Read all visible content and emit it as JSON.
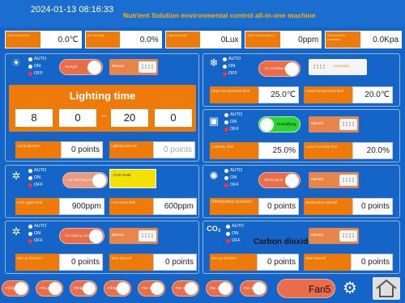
{
  "header": {
    "datetime": "2024-01-13 08:16:33",
    "title": "Nutrient Solution environmental control all-in-one machine"
  },
  "sensors": [
    {
      "label": "Air temperature",
      "value": "0.0℃"
    },
    {
      "label": "Air humidity",
      "value": "0.0%"
    },
    {
      "label": "Light intensity",
      "value": "0Lux"
    },
    {
      "label": "CO2 concentration",
      "value": "0ppm"
    },
    {
      "label": "Atmospheric pressure",
      "value": "0.0Kpa"
    }
  ],
  "modes": {
    "auto": "AUTO",
    "on": "ON",
    "off": "OFF"
  },
  "lighting": {
    "toggle": "Streight",
    "manual": "Manual",
    "title": "Lighting time",
    "start_h": "8",
    "start_m": "0",
    "sep": "--",
    "end_h": "20",
    "end_m": "0",
    "duration_label": "Lamp duration",
    "duration_value": "0 points",
    "interval_label": "Lighting interval",
    "interval_value": "0 points"
  },
  "aircon": {
    "toggle": "Air conditioner",
    "auto_btn": "Automatic",
    "upper_label": "Upper temperature limit",
    "upper_value": "25.0℃",
    "lower_label": "Lower temperature limit",
    "lower_value": "20.0℃"
  },
  "humid": {
    "toggle": "Humidifying",
    "manual": "Manual",
    "limit_label": "Humidity limit",
    "limit_value": "25.0%",
    "lower_label": "Lower humidity limit",
    "lower_value": "20.0%"
  },
  "co2": {
    "toggle": "Air handling on",
    "mode_label": "CO2 mode",
    "upper_label": "CO2 upper limit",
    "upper_value": "900ppm",
    "lower_label": "CO2 lower limit",
    "lower_value": "600ppm"
  },
  "steril": {
    "toggle": "Sterilization",
    "manual": "Manual",
    "duration_label": "Sterilization duration",
    "duration_value": "0 points",
    "interval_label": "Sterilization interval",
    "interval_value": "0 points"
  },
  "circ": {
    "toggle": "Circulating wind",
    "manual": "Manual",
    "duration_label": "Set-up duration",
    "duration_value": "0 points",
    "interval_label": "Start interval",
    "interval_value": "0 points"
  },
  "carbon": {
    "title": "Carbon dioxide",
    "manual": "Manual",
    "duration_label": "Set-up duration",
    "duration_value": "0 points",
    "interval_label": "Start interval",
    "interval_value": "0 points"
  },
  "bottom": {
    "b1": "Fill light 1",
    "b2": "Fill Light 2",
    "b3": "Fill light 3",
    "b4": "Fill light 4",
    "b5": "Fan 1",
    "b6": "Fan 2",
    "b7": "Fan 3",
    "b8": "Fan 4",
    "fan5": "Fan5"
  },
  "colors": {
    "background": "#1565c8",
    "orange": "#ee7a0a",
    "toggle_off": "#e86d48",
    "toggle_on": "#2bd430",
    "title": "#ffb000"
  }
}
